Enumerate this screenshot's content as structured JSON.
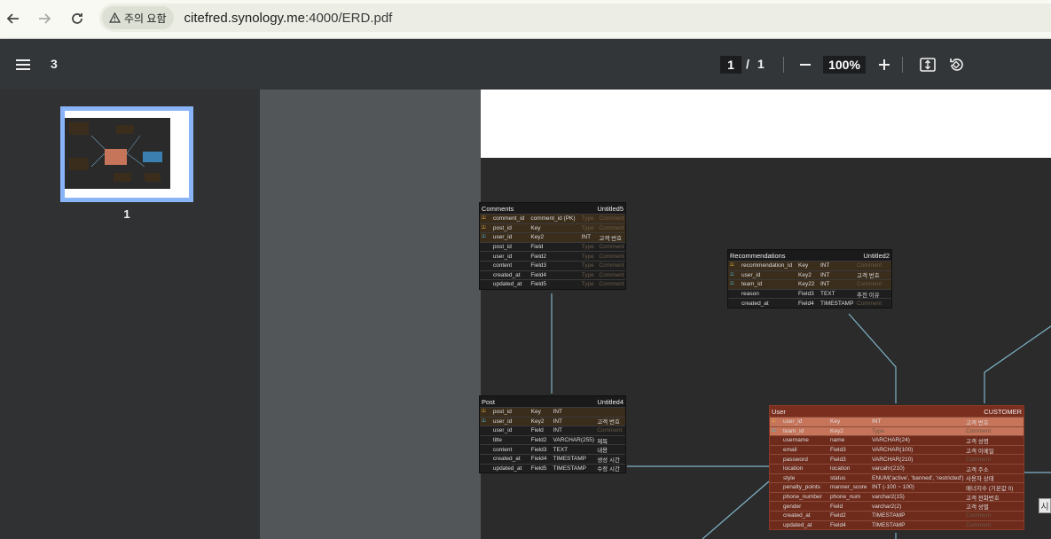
{
  "browser": {
    "security_label": "주의 요함",
    "url_host": "citefred.synology.me",
    "url_path": ":4000/ERD.pdf"
  },
  "toolbar": {
    "page_count_badge": "3",
    "current_page": "1",
    "page_separator": "/",
    "total_pages": "1",
    "zoom": "100%"
  },
  "sidebar": {
    "thumbnails": [
      {
        "label": "1"
      }
    ]
  },
  "erd": {
    "tables": [
      {
        "name": "Comments",
        "tag": "Untitled5",
        "rows": [
          {
            "icon": "pk-key-icon",
            "field": "comment_id",
            "key": "comment_id (PK)",
            "type": "Type",
            "comment": "Comment"
          },
          {
            "icon": "pk-key-icon",
            "field": "post_id",
            "key": "Key",
            "type": "Type",
            "comment": "Comment"
          },
          {
            "icon": "fk-key-icon",
            "field": "user_id",
            "key": "Key2",
            "type": "INT",
            "comment": "고객 번호"
          },
          {
            "icon": "",
            "field": "post_id",
            "key": "Field",
            "type": "Type",
            "comment": "Comment"
          },
          {
            "icon": "",
            "field": "user_id",
            "key": "Field2",
            "type": "Type",
            "comment": "Comment"
          },
          {
            "icon": "",
            "field": "content",
            "key": "Field3",
            "type": "Type",
            "comment": "Comment"
          },
          {
            "icon": "",
            "field": "created_at",
            "key": "Field4",
            "type": "Type",
            "comment": "Comment"
          },
          {
            "icon": "",
            "field": "updated_at",
            "key": "Field5",
            "type": "Type",
            "comment": "Comment"
          }
        ]
      },
      {
        "name": "Recommendations",
        "tag": "Untitled2",
        "rows": [
          {
            "icon": "pk-key-icon",
            "field": "recommendation_id",
            "key": "Key",
            "type": "INT",
            "comment": "Comment"
          },
          {
            "icon": "fk-key-icon",
            "field": "user_id",
            "key": "Key2",
            "type": "INT",
            "comment": "고객 번호"
          },
          {
            "icon": "fk-key-icon",
            "field": "team_id",
            "key": "Key22",
            "type": "INT",
            "comment": "Comment"
          },
          {
            "icon": "",
            "field": "reason",
            "key": "Field3",
            "type": "TEXT",
            "comment": "추천 이유"
          },
          {
            "icon": "",
            "field": "created_at",
            "key": "Field4",
            "type": "TIMESTAMP",
            "comment": "Comment"
          }
        ]
      },
      {
        "name": "Post",
        "tag": "Untitled4",
        "rows": [
          {
            "icon": "pk-key-icon",
            "field": "post_id",
            "key": "Key",
            "type": "INT",
            "comment": ""
          },
          {
            "icon": "fk-key-icon",
            "field": "user_id",
            "key": "Key2",
            "type": "INT",
            "comment": "고객 번호"
          },
          {
            "icon": "",
            "field": "user_id",
            "key": "Field",
            "type": "INT",
            "comment": "Comment"
          },
          {
            "icon": "",
            "field": "title",
            "key": "Field2",
            "type": "VARCHAR(255)",
            "comment": "제목"
          },
          {
            "icon": "",
            "field": "content",
            "key": "Field3",
            "type": "TEXT",
            "comment": "내용"
          },
          {
            "icon": "",
            "field": "created_at",
            "key": "Field4",
            "type": "TIMESTAMP",
            "comment": "생성 시간"
          },
          {
            "icon": "",
            "field": "updated_at",
            "key": "Field5",
            "type": "TIMESTAMP",
            "comment": "수정 시간"
          }
        ]
      },
      {
        "name": "User",
        "tag": "CUSTOMER",
        "rows": [
          {
            "icon": "pk-key-icon",
            "field": "user_id",
            "key": "Key",
            "type": "INT",
            "comment": "고객 번호"
          },
          {
            "icon": "fk-key-icon",
            "field": "team_id",
            "key": "Key2",
            "type": "Type",
            "comment": "Comment"
          },
          {
            "icon": "",
            "field": "username",
            "key": "name",
            "type": "VARCHAR(24)",
            "comment": "고객 성명"
          },
          {
            "icon": "",
            "field": "email",
            "key": "Field3",
            "type": "VARCHAR(100)",
            "comment": "고객 이메일"
          },
          {
            "icon": "",
            "field": "password",
            "key": "Field3",
            "type": "VARCHAR(210)",
            "comment": "Comment"
          },
          {
            "icon": "",
            "field": "location",
            "key": "location",
            "type": "varcahr(210)",
            "comment": "고객 주소"
          },
          {
            "icon": "",
            "field": "style",
            "key": "status",
            "type": "ENUM('active', 'banned', 'restricted')",
            "comment": "사용자 상태"
          },
          {
            "icon": "",
            "field": "penalty_points",
            "key": "manner_score",
            "type": "INT (-100 ~ 100)",
            "comment": "매너지수 (기본값 0)"
          },
          {
            "icon": "",
            "field": "phone_number",
            "key": "phone_num",
            "type": "varchar2(15)",
            "comment": "고객 전화번호"
          },
          {
            "icon": "",
            "field": "gender",
            "key": "Field",
            "type": "varchar2(2)",
            "comment": "고객 성별"
          },
          {
            "icon": "",
            "field": "created_at",
            "key": "Field2",
            "type": "TIMESTAMP",
            "comment": "Comment"
          },
          {
            "icon": "",
            "field": "updated_at",
            "key": "Field4",
            "type": "TIMESTAMP",
            "comment": "Comment"
          }
        ]
      }
    ],
    "tooltip_text": "시"
  }
}
